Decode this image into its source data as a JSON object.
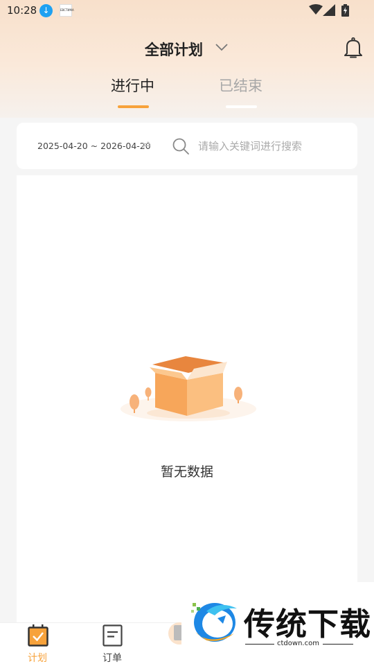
{
  "status_bar": {
    "time": "10:28",
    "app_icon_text": "ЕВСТИМА",
    "icons": [
      "download-icon",
      "wifi-icon",
      "signal-icon",
      "battery-icon"
    ]
  },
  "header": {
    "title": "全部计划",
    "icons": [
      "chevron-down-icon",
      "bell-icon"
    ]
  },
  "tabs": [
    {
      "label": "进行中",
      "active": true
    },
    {
      "label": "已结束",
      "active": false
    }
  ],
  "filter": {
    "date_range": "2025-04-20 ~ 2026-04-20",
    "swap_symbol": "⇌",
    "search_placeholder": "请输入关键词进行搜索",
    "search_value": ""
  },
  "empty_state": {
    "text": "暂无数据",
    "illustration": "empty-box-illustration"
  },
  "bottom_nav": [
    {
      "label": "计划",
      "icon": "calendar-check-icon",
      "active": true
    },
    {
      "label": "订单",
      "icon": "order-doc-icon",
      "active": false
    }
  ],
  "watermark": {
    "text": "传统下载",
    "url": "ctdown.com"
  },
  "colors": {
    "accent": "#f7a23b",
    "header_gradient_top": "#f8e0cb",
    "page_background": "#f5f5f5",
    "inactive_tab": "#a8a8a8"
  }
}
